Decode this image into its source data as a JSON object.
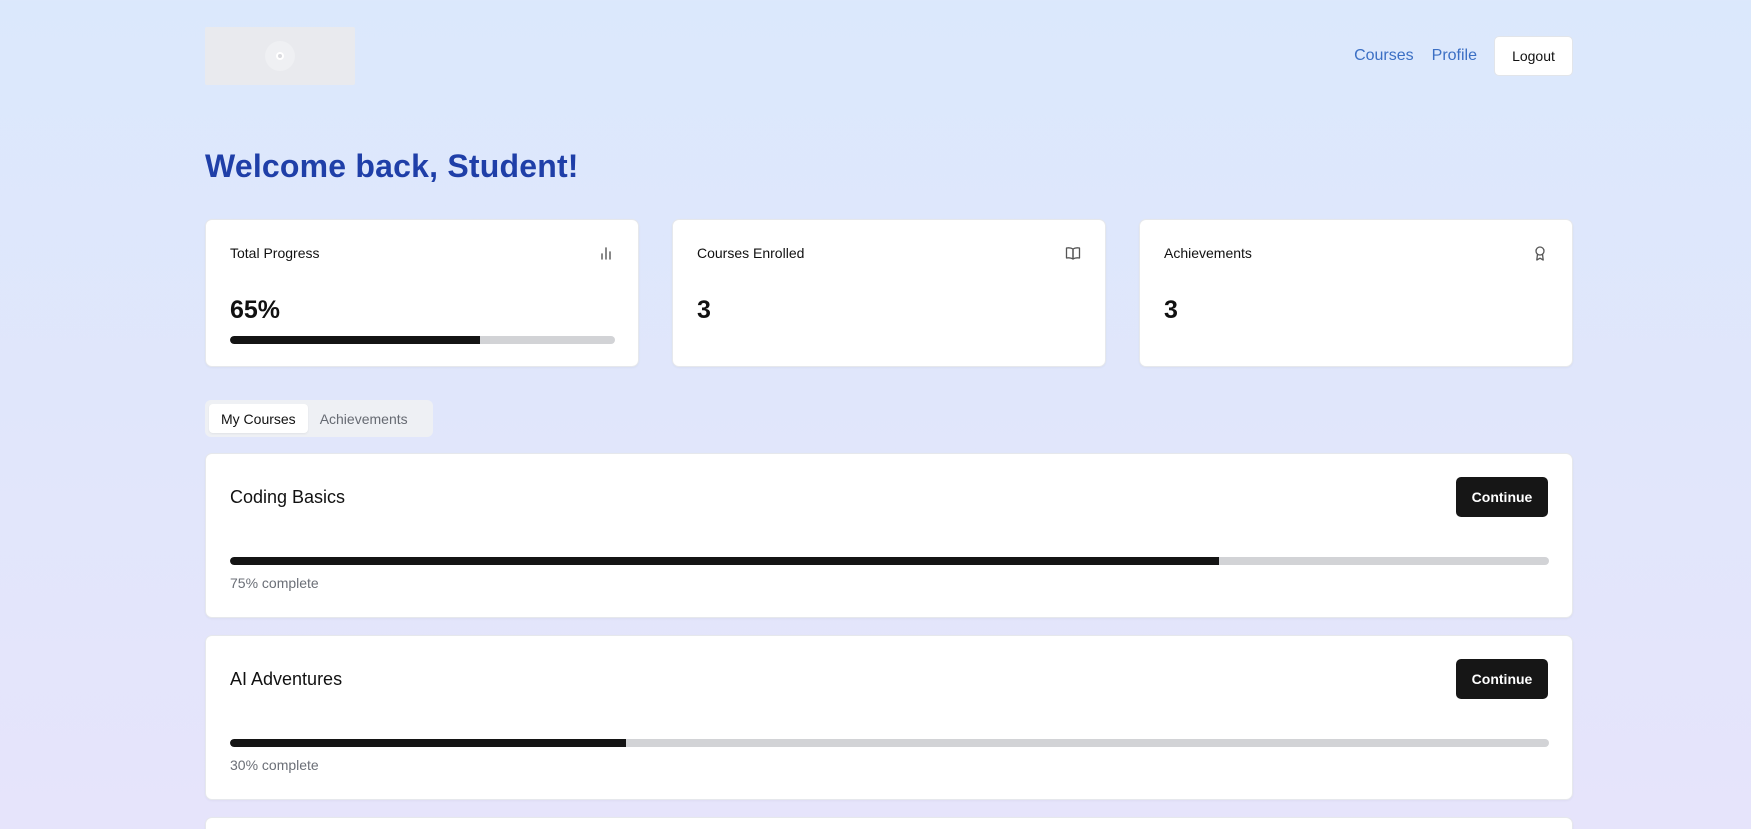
{
  "header": {
    "nav": {
      "courses_label": "Courses",
      "profile_label": "Profile",
      "logout_label": "Logout"
    }
  },
  "welcome": {
    "title": "Welcome back, Student!"
  },
  "stats": [
    {
      "label": "Total Progress",
      "value": "65%",
      "icon": "bar-chart-icon",
      "progress_fraction": 0.65
    },
    {
      "label": "Courses Enrolled",
      "value": "3",
      "icon": "book-open-icon"
    },
    {
      "label": "Achievements",
      "value": "3",
      "icon": "award-icon"
    }
  ],
  "tabs": [
    {
      "label": "My Courses",
      "active": true
    },
    {
      "label": "Achievements",
      "active": false
    }
  ],
  "courses": [
    {
      "title": "Coding Basics",
      "button_label": "Continue",
      "progress_fraction": 0.75,
      "caption": "75% complete"
    },
    {
      "title": "AI Adventures",
      "button_label": "Continue",
      "progress_fraction": 0.3,
      "caption": "30% complete"
    }
  ],
  "colors": {
    "accent_heading": "#1f3fa8",
    "link": "#3b6fc4",
    "primary_button": "#161616",
    "progress_fill": "#141414",
    "progress_track": "#d2d3d6"
  }
}
